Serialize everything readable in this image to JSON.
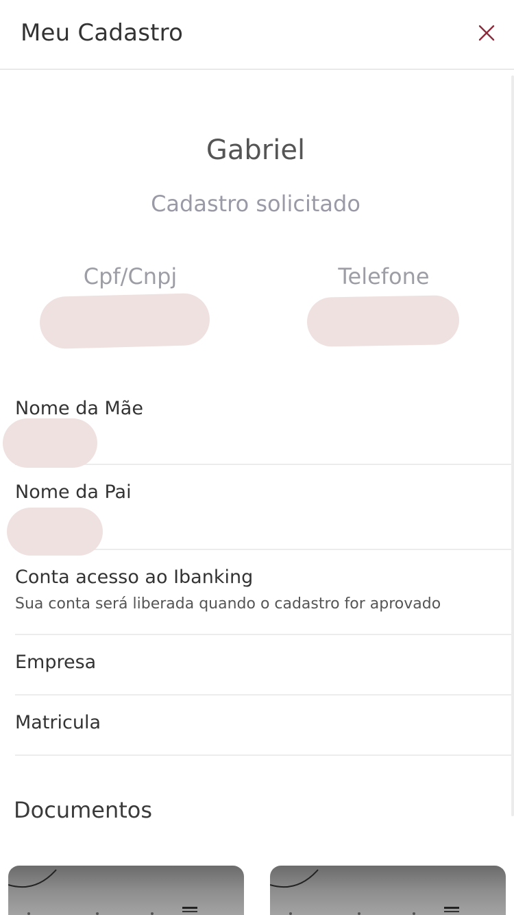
{
  "header": {
    "title": "Meu Cadastro",
    "close_icon": "close-icon",
    "close_color": "#8b2b3b"
  },
  "profile": {
    "name": "Gabriel",
    "status": "Cadastro solicitado",
    "cpf_label": "Cpf/Cnpj",
    "phone_label": "Telefone"
  },
  "fields": [
    {
      "label": "Nome da Mãe"
    },
    {
      "label": "Nome da Pai"
    },
    {
      "label": "Conta acesso ao Ibanking",
      "sub": "Sua conta será liberada quando o cadastro for aprovado"
    },
    {
      "label": "Empresa"
    },
    {
      "label": "Matricula"
    }
  ],
  "documents": {
    "title": "Documentos"
  },
  "colors": {
    "redacted": "#efe1df",
    "accent": "#8b2b3b"
  }
}
